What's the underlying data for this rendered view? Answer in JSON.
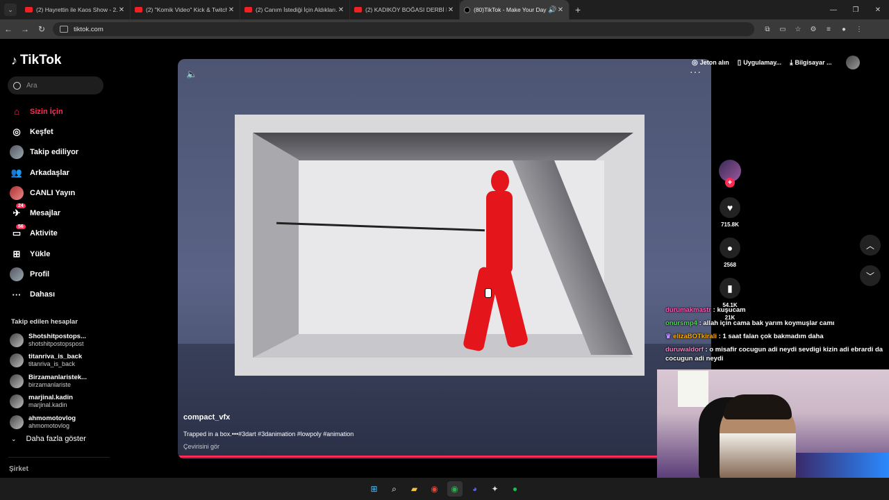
{
  "browser": {
    "tabs": [
      {
        "title": "(2) Hayrettin ile Kaos Show - 2...",
        "icon": "youtube-icon"
      },
      {
        "title": "(2) \"Komik Video\" Kick & Twitch",
        "icon": "youtube-icon"
      },
      {
        "title": "(2) Canım İstediği İçin Aldıkları...",
        "icon": "youtube-icon"
      },
      {
        "title": "(2) KADIKÖY BOĞASI DERBİ KE...",
        "icon": "youtube-icon"
      },
      {
        "title": "(80)TikTok - Make Your Day",
        "icon": "tiktok-icon",
        "active": true
      }
    ],
    "url": "tiktok.com"
  },
  "sidebar": {
    "logo": "TikTok",
    "search_placeholder": "Ara",
    "menu": [
      {
        "label": "Sizin İçin",
        "icon": "home-icon",
        "active": true
      },
      {
        "label": "Keşfet",
        "icon": "compass-icon"
      },
      {
        "label": "Takip ediliyor",
        "icon": "following-avatar"
      },
      {
        "label": "Arkadaşlar",
        "icon": "friends-icon"
      },
      {
        "label": "CANLI Yayın",
        "icon": "live-avatar"
      },
      {
        "label": "Mesajlar",
        "icon": "messages-icon",
        "badge": "24"
      },
      {
        "label": "Aktivite",
        "icon": "activity-icon",
        "badge": "56"
      },
      {
        "label": "Yükle",
        "icon": "upload-icon"
      },
      {
        "label": "Profil",
        "icon": "profile-avatar"
      },
      {
        "label": "Dahası",
        "icon": "more-icon"
      }
    ],
    "followed_title": "Takip edilen hesaplar",
    "accounts": [
      {
        "name": "Shotshitpostops...",
        "user": "shotshitpostopspost"
      },
      {
        "name": "titanriva_is_back",
        "user": "titanriva_is_back"
      },
      {
        "name": "Birzamanlaristek...",
        "user": "birzamanlariste"
      },
      {
        "name": "marjinal.kadin",
        "user": "marjinal.kadin"
      },
      {
        "name": "ahmomotovlog",
        "user": "ahmomotovlog"
      }
    ],
    "show_more": "Daha fazla göster",
    "company": "Şirket"
  },
  "header": {
    "coins": "Jeton alın",
    "app": "Uygulamay...",
    "computer": "Bilgisayar ..."
  },
  "video": {
    "author": "compact_vfx",
    "description": "Trapped in a box.•••#3dart #3danimation #lowpoly #animation",
    "translate": "Çevirisini gör",
    "progress": 0.9
  },
  "actions": {
    "likes": "715.8K",
    "comments": "2568",
    "saves": "54.1K",
    "shares": "21K"
  },
  "chat": [
    {
      "user": "durumakmastr",
      "text": " : kuşucam"
    },
    {
      "user": "onursmp4",
      "text": " : allah için cama bak yarım koymuşlar camı"
    },
    {
      "user": "elizaBOTkirali",
      "text": " : 1 saat falan çok bakmadım daha"
    },
    {
      "user": "duruwaldorf",
      "text": " : o misafir cocugun adi neydi sevdigi kizin adi ebrardi da cocugun adi neydi"
    }
  ],
  "colors": {
    "accent": "#fe2c55",
    "background": "#000000"
  }
}
